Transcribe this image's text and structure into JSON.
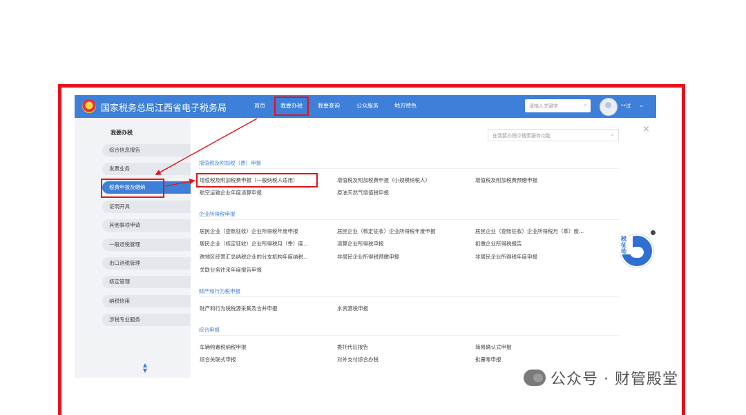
{
  "header": {
    "title": "国家税务总局江西省电子税务局",
    "nav": [
      "首页",
      "我要办税",
      "我要查询",
      "公众服务",
      "地方特色"
    ],
    "search_placeholder": "请输入关键字",
    "user_name": "**试",
    "user_caret": "⌄"
  },
  "sidebar": {
    "title": "我要办税",
    "items": [
      "综合信息报告",
      "发票业务",
      "税费申报及缴纳",
      "证明开具",
      "其他事项申请",
      "一般退税管理",
      "出口退税管理",
      "核定管理",
      "纳税信用",
      "涉税专业服务"
    ],
    "active_index": 2
  },
  "panel": {
    "search_placeholder": "在我要办税中搜索服务功能",
    "close": "×",
    "sections": [
      {
        "title": "增值税及附加税（费）申报",
        "items": [
          "增值税及附加税费申报（一般纳税人适用）",
          "增值税及附加税费申报（小规模纳税人）",
          "增值税及附加税费预缴申报",
          "航空运输企业年度清算申报",
          "原油天然气增值税申报"
        ]
      },
      {
        "title": "企业所得税申报",
        "items": [
          "居民企业（查账征收）企业所得税年度申报",
          "居民企业（核定征收）企业所得税年度申报",
          "居民企业（查账征收）企业所得税月（季）度...",
          "居民企业（核定征收）企业所得税月（季）度...",
          "清算企业所得税申报",
          "扣缴企业所得税报告",
          "跨地区经营汇总纳税企业的分支机构年度纳税...",
          "非居民企业所得税预缴申报",
          "非居民企业所得税年度申报",
          "关联业务往来年度报告申报"
        ]
      },
      {
        "title": "财产和行为税申报",
        "items": [
          "财产和行为税税源采集及合并申报",
          "水资源税申报"
        ]
      },
      {
        "title": "综合申报",
        "items": [
          "车辆购置税纳税申报",
          "委托代征报告",
          "简易确认式申报",
          "综合关联式申报",
          "对外支付综合办税",
          "批量零申报"
        ]
      }
    ]
  },
  "helper": {
    "label": "税 征 动",
    "label_lines": [
      "税",
      "征",
      "动"
    ]
  },
  "watermark": {
    "text": "公众号 · 财管殿堂"
  },
  "colors": {
    "brand_blue": "#3d7fd9",
    "highlight_red": "#e8101a"
  }
}
